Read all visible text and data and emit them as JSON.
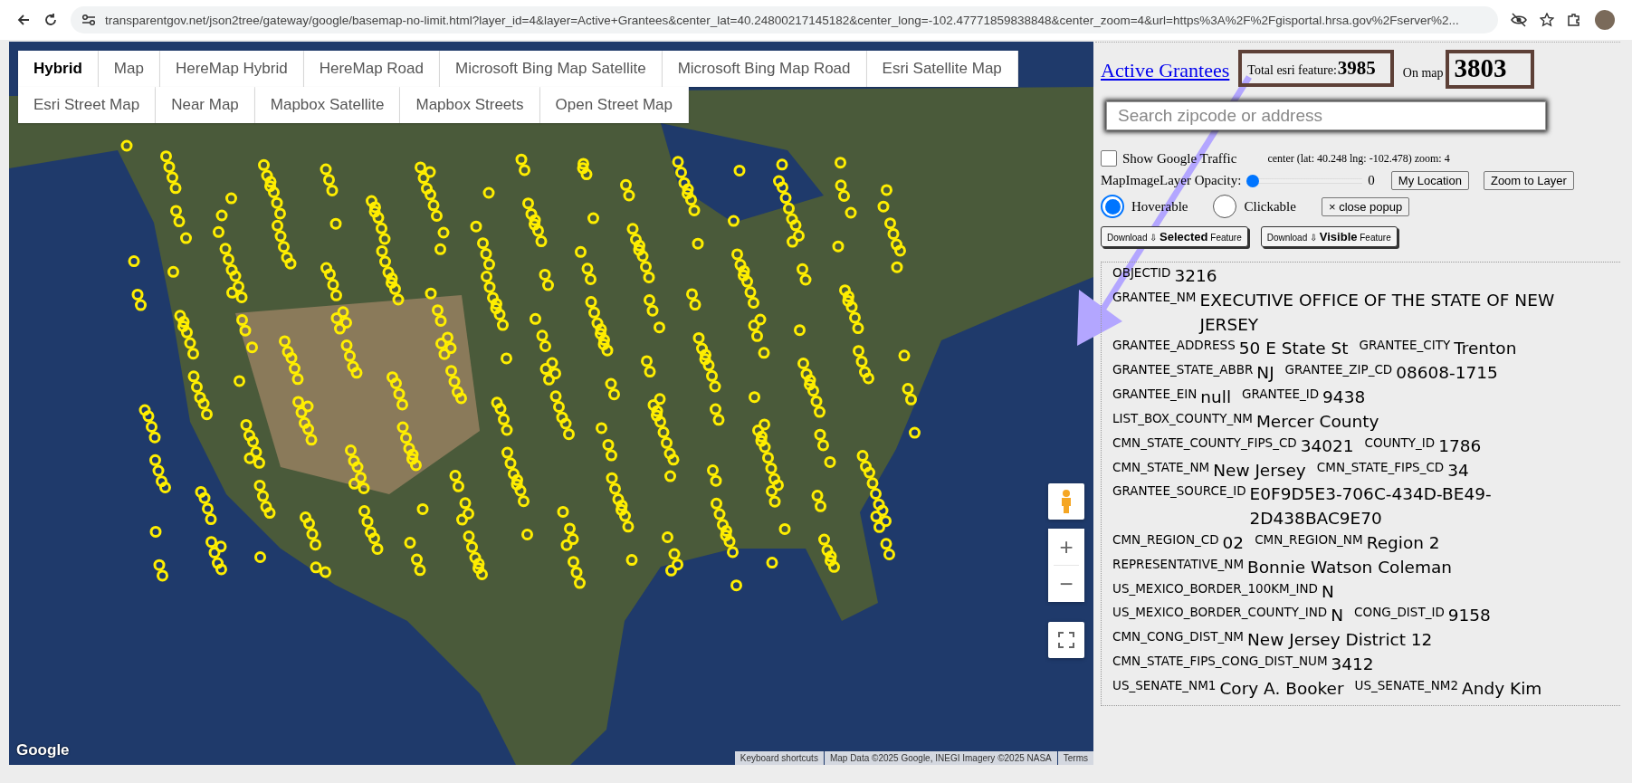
{
  "browser": {
    "url": "transparentgov.net/json2tree/gateway/google/basemap-no-limit.html?layer_id=4&layer=Active+Grantees&center_lat=40.24800217145182&center_long=-102.47771859838848&center_zoom=4&url=https%3A%2F%2Fgisportal.hrsa.gov%2Fserver%2..."
  },
  "map": {
    "basemap_tabs": [
      {
        "label": "Hybrid",
        "selected": true
      },
      {
        "label": "Map",
        "selected": false
      },
      {
        "label": "HereMap Hybrid",
        "selected": false
      },
      {
        "label": "HereMap Road",
        "selected": false
      },
      {
        "label": "Microsoft Bing Map Satellite",
        "selected": false
      },
      {
        "label": "Microsoft Bing Map Road",
        "selected": false
      },
      {
        "label": "Esri Satellite Map",
        "selected": false
      },
      {
        "label": "Esri Street Map",
        "selected": false
      },
      {
        "label": "Near Map",
        "selected": false
      },
      {
        "label": "Mapbox Satellite",
        "selected": false
      },
      {
        "label": "Mapbox Streets",
        "selected": false
      },
      {
        "label": "Open Street Map",
        "selected": false
      }
    ],
    "zoom_in": "+",
    "zoom_out": "−",
    "logo": "Google",
    "attribution": [
      "Keyboard shortcuts",
      "Map Data ©2025 Google, INEGI Imagery ©2025 NASA",
      "Terms"
    ]
  },
  "panel": {
    "layer_link": "Active Grantees",
    "total_label": "Total esri feature:",
    "total_count": "3985",
    "on_map_label": "On map",
    "on_map_count": "3803",
    "search": {
      "placeholder": "Search zipcode or address"
    },
    "traffic": {
      "label": "Show Google Traffic",
      "checked": false
    },
    "center_info": "center (lat: 40.248 lng: -102.478) zoom: 4",
    "opacity": {
      "label": "MapImageLayer Opacity:",
      "level": 0,
      "reading": "0"
    },
    "buttons": [
      "My Location",
      "Zoom to Layer"
    ],
    "modes": [
      {
        "label": "Hoverable",
        "selected": true
      },
      {
        "label": "Clickable",
        "selected": false
      }
    ],
    "close_popup": "× close popup",
    "downloads": [
      "Download ⇩ **Selected** Feature",
      "Download ⇩ **Visible** Feature"
    ],
    "fields": [
      [
        {
          "label": "OBJECTID",
          "value": "3216"
        }
      ],
      [
        {
          "label": "GRANTEE_NM",
          "value": "EXECUTIVE OFFICE OF THE STATE OF NEW JERSEY"
        }
      ],
      [
        {
          "label": "GRANTEE_ADDRESS",
          "value": "50 E State St"
        },
        {
          "label": "GRANTEE_CITY",
          "value": "Trenton"
        }
      ],
      [
        {
          "label": "GRANTEE_STATE_ABBR",
          "value": "NJ"
        },
        {
          "label": "GRANTEE_ZIP_CD",
          "value": "08608-1715"
        }
      ],
      [
        {
          "label": "GRANTEE_EIN",
          "value": "null"
        },
        {
          "label": "GRANTEE_ID",
          "value": "9438"
        }
      ],
      [
        {
          "label": "LIST_BOX_COUNTY_NM",
          "value": "Mercer County"
        }
      ],
      [
        {
          "label": "CMN_STATE_COUNTY_FIPS_CD",
          "value": "34021"
        },
        {
          "label": "COUNTY_ID",
          "value": "1786"
        }
      ],
      [
        {
          "label": "CMN_STATE_NM",
          "value": "New Jersey"
        },
        {
          "label": "CMN_STATE_FIPS_CD",
          "value": "34"
        }
      ],
      [
        {
          "label": "GRANTEE_SOURCE_ID",
          "value": "E0F9D5E3-706C-434D-BE49-2D438BAC9E70"
        }
      ],
      [
        {
          "label": "CMN_REGION_CD",
          "value": "02"
        },
        {
          "label": "CMN_REGION_NM",
          "value": "Region 2"
        }
      ],
      [
        {
          "label": "REPRESENTATIVE_NM",
          "value": "Bonnie Watson Coleman"
        }
      ],
      [
        {
          "label": "US_MEXICO_BORDER_100KM_IND",
          "value": "N"
        }
      ],
      [
        {
          "label": "US_MEXICO_BORDER_COUNTY_IND",
          "value": "N"
        },
        {
          "label": "CONG_DIST_ID",
          "value": "9158"
        }
      ],
      [
        {
          "label": "CMN_CONG_DIST_NM",
          "value": "New Jersey District 12"
        }
      ],
      [
        {
          "label": "CMN_STATE_FIPS_CONG_DIST_NUM",
          "value": "3412"
        }
      ],
      [
        {
          "label": "US_SENATE_NM1",
          "value": "Cory A. Booker"
        },
        {
          "label": "US_SENATE_NM2",
          "value": "Andy Kim"
        }
      ]
    ]
  }
}
